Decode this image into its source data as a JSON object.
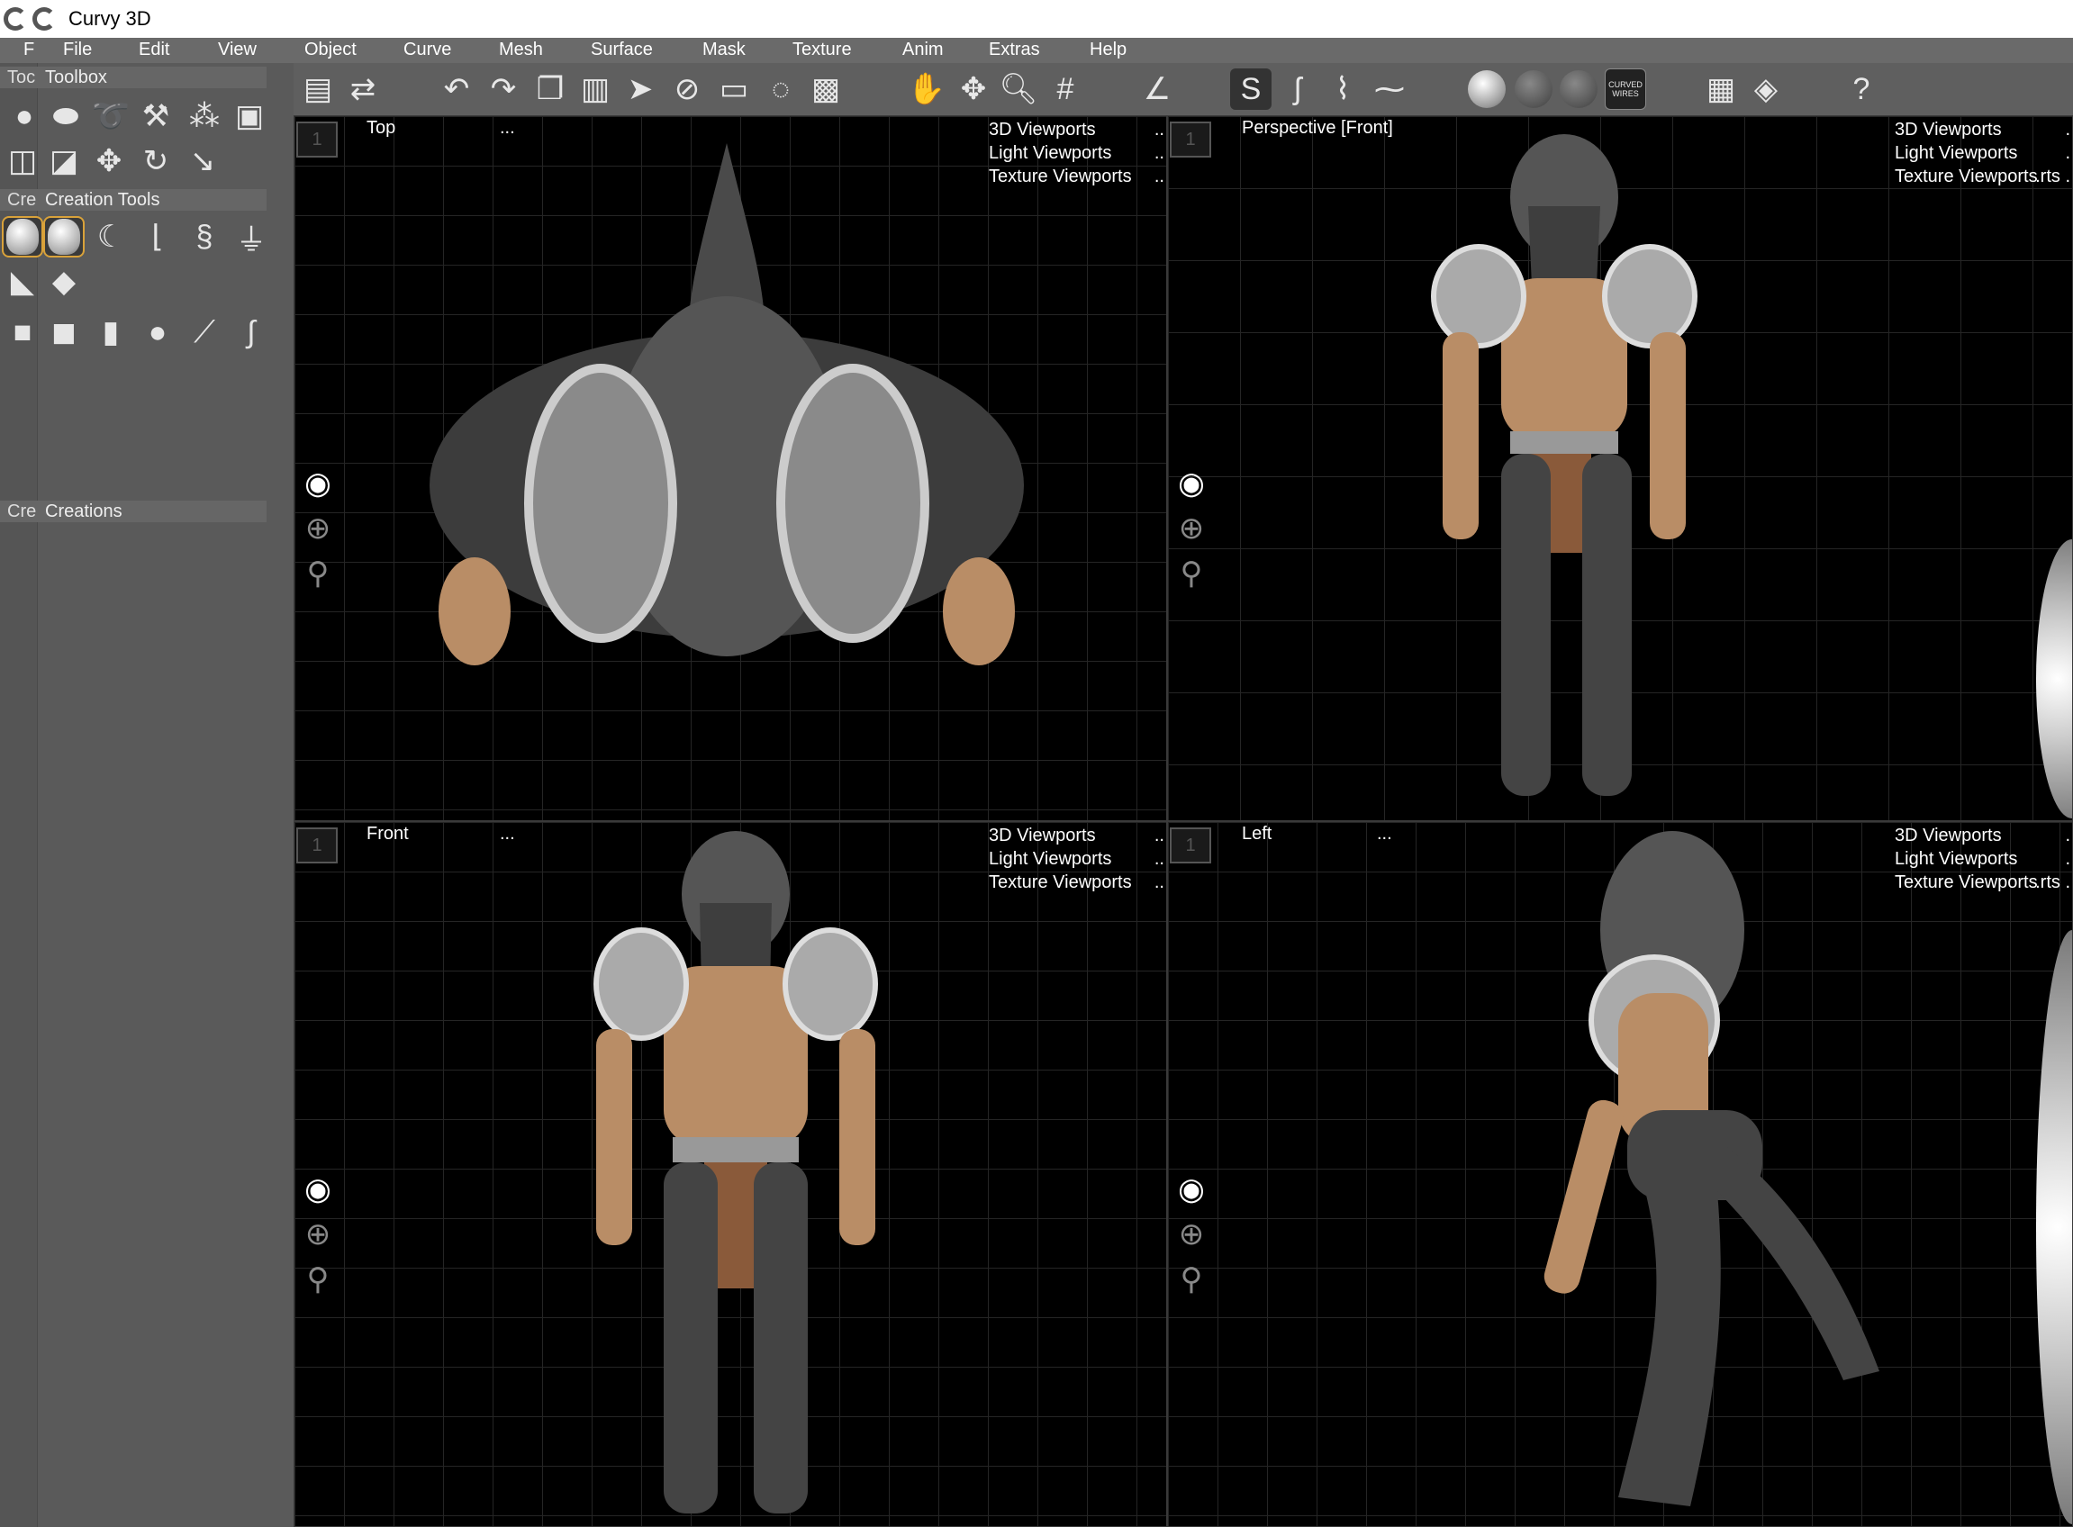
{
  "window": {
    "title": "Curvy 3D"
  },
  "menu": [
    "F",
    "File",
    "Edit",
    "View",
    "Object",
    "Curve",
    "Mesh",
    "Surface",
    "Mask",
    "Texture",
    "Anim",
    "Extras",
    "Help"
  ],
  "toolbar": {
    "curved_wires_label": "CURVED WIRES"
  },
  "left_panel": {
    "toolbox": {
      "short": "Toc",
      "title": "Toolbox"
    },
    "creation_tools": {
      "short": "Cre",
      "title": "Creation Tools"
    },
    "creations": {
      "short": "Cre",
      "title": "Creations"
    }
  },
  "viewports": {
    "top": {
      "name": "Top",
      "dots": "...",
      "menu": [
        "3D Viewports",
        "Light Viewports",
        "Texture Viewports"
      ],
      "tail": [
        "..",
        "..",
        ".."
      ],
      "num": "1"
    },
    "perspective": {
      "name": "Perspective [Front]",
      "dots": "",
      "menu": [
        "3D Viewports",
        "Light Viewports",
        "Texture Viewports"
      ],
      "tail": [
        ".",
        ".",
        ".rts ."
      ],
      "num": "1"
    },
    "front": {
      "name": "Front",
      "dots": "...",
      "menu": [
        "3D Viewports",
        "Light Viewports",
        "Texture Viewports"
      ],
      "tail": [
        "..",
        "..",
        ".."
      ],
      "num": "1"
    },
    "left": {
      "name": "Left",
      "dots": "...",
      "menu": [
        "3D Viewports",
        "Light Viewports",
        "Texture Viewports"
      ],
      "tail": [
        ".",
        ".",
        ".rts ."
      ],
      "num": "1"
    }
  },
  "colors": {
    "panel": "#5a5a5a",
    "menubar": "#6a6a6a",
    "viewport_bg": "#000000",
    "selection": "#d9a23a",
    "grid": "#2a2a2a"
  }
}
